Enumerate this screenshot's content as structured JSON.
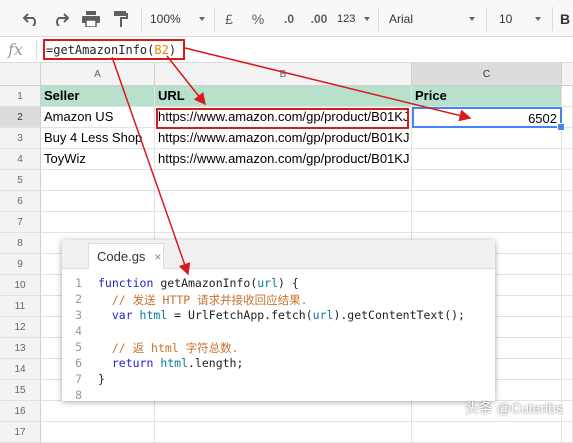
{
  "toolbar": {
    "zoom": "100%",
    "currency": "£",
    "percent": "%",
    "decrease_decimals": ".0",
    "increase_decimals": ".00",
    "more_formats": "123",
    "font": "Arial",
    "font_size": "10"
  },
  "formula_bar": {
    "fx_label": "fx",
    "formula_prefix": "=getAmazonInfo(",
    "formula_ref": "B2",
    "formula_suffix": ")"
  },
  "sheet": {
    "columns": [
      "A",
      "B",
      "C"
    ],
    "rows": [
      "1",
      "2",
      "3",
      "4",
      "5",
      "6",
      "7",
      "8",
      "9",
      "10",
      "11",
      "12",
      "13",
      "14",
      "15",
      "16",
      "17"
    ],
    "header_row": [
      "Seller",
      "URL",
      "Price"
    ],
    "data": [
      [
        "Amazon US",
        "https://www.amazon.com/gp/product/B01KJ",
        "6502"
      ],
      [
        "Buy 4 Less Shop",
        "https://www.amazon.com/gp/product/B01KJ",
        ""
      ],
      [
        "ToyWiz",
        "https://www.amazon.com/gp/product/B01KJ",
        ""
      ]
    ]
  },
  "editor": {
    "tab_label": "Code.gs",
    "tab_close": "×",
    "line_numbers": [
      "1",
      "2",
      "3",
      "4",
      "5",
      "6",
      "7",
      "8"
    ],
    "code": {
      "l1_kw": "function",
      "l1_rest_a": " getAmazonInfo(",
      "l1_param": "url",
      "l1_rest_b": ") {",
      "l2_comment": "  // 发送 HTTP 请求并接收回应结果.",
      "l3_kw": "  var",
      "l3_var": " html",
      "l3_rest_a": " = UrlFetchApp.fetch(",
      "l3_param": "url",
      "l3_rest_b": ").getContentText();",
      "l5_comment": "  // 返 html 字符总数.",
      "l6_kw": "  return",
      "l6_var": " html",
      "l6_rest": ".length;",
      "l7": "}"
    }
  },
  "watermark": "头条 @Cuteribs",
  "colors": {
    "header_fill": "#b7e1cd",
    "selection_blue": "#4285f4",
    "annotation_red": "#d91a1a"
  }
}
